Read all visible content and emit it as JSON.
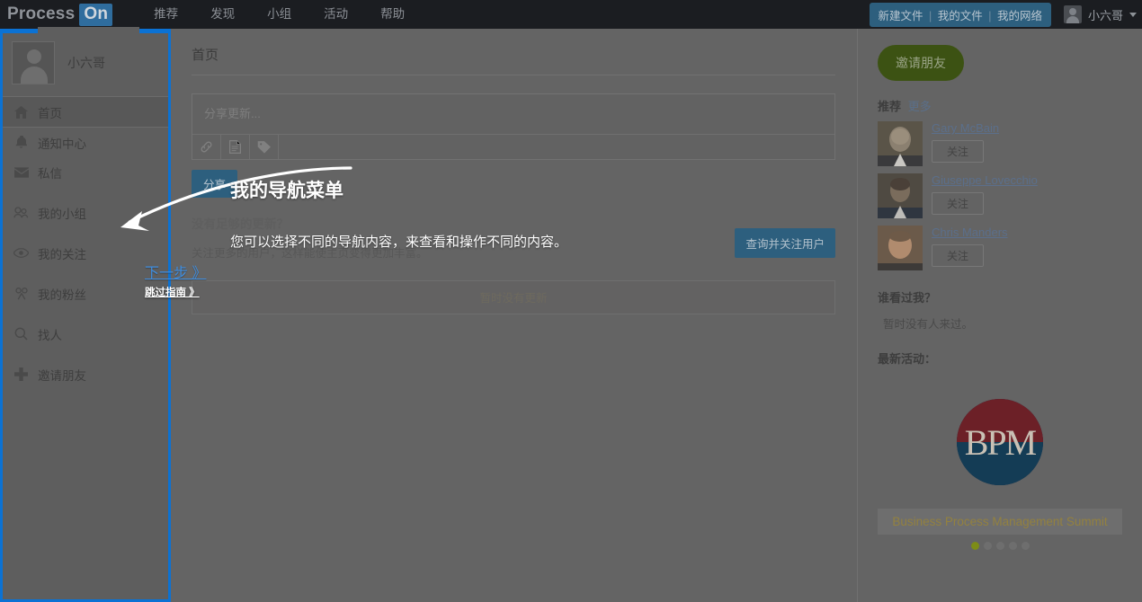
{
  "topnav": {
    "logo_process": "Process",
    "logo_on": "On",
    "links": [
      "推荐",
      "发现",
      "小组",
      "活动",
      "帮助"
    ],
    "file_buttons": [
      "新建文件",
      "我的文件",
      "我的网络"
    ],
    "separator": "|",
    "user_name": "小六哥",
    "avatar_icon": "user-avatar-icon",
    "caret_icon": "chevron-down-icon"
  },
  "sidebar": {
    "profile_name": "小六哥",
    "profile_avatar_icon": "user-avatar-icon",
    "items": [
      {
        "label": "首页",
        "icon": "home-icon",
        "glyph": "⌂",
        "active": true
      },
      {
        "label": "通知中心",
        "icon": "bell-icon",
        "glyph": "🔔",
        "active": false
      },
      {
        "label": "私信",
        "icon": "envelope-icon",
        "glyph": "✉",
        "active": false
      },
      {
        "label": "我的小组",
        "icon": "group-icon",
        "glyph": "👥",
        "active": false
      },
      {
        "label": "我的关注",
        "icon": "eye-icon",
        "glyph": "◉",
        "active": false
      },
      {
        "label": "我的粉丝",
        "icon": "fans-icon",
        "glyph": "☍",
        "active": false
      },
      {
        "label": "找人",
        "icon": "search-icon",
        "glyph": "🔍",
        "active": false
      },
      {
        "label": "邀请朋友",
        "icon": "plus-cross-icon",
        "glyph": "✚",
        "active": false
      }
    ]
  },
  "main": {
    "page_title": "首页",
    "share_placeholder": "分享更新...",
    "share_tools": [
      {
        "name": "attach-link-icon",
        "glyph": "🔗"
      },
      {
        "name": "attach-document-icon",
        "glyph": "📄"
      },
      {
        "name": "attach-tag-icon",
        "glyph": "🏷"
      }
    ],
    "share_button": "分享",
    "empty_heading": "没有足够的更新？",
    "empty_text": "关注更多的用户，这样能使主页变得更加丰富。",
    "follow_users_button": "查询并关注用户",
    "no_updates": "暂时没有更新"
  },
  "rightbar": {
    "invite_button": "邀请朋友",
    "recommend_label": "推荐",
    "recommend_more": "更多",
    "people": [
      {
        "name": "Gary McBain",
        "follow": "关注"
      },
      {
        "name": "Giuseppe Lovecchio",
        "follow": "关注"
      },
      {
        "name": "Chris Manders",
        "follow": "关注"
      }
    ],
    "visitors_heading": "谁看过我？",
    "visitors_text": "暂时没有人来过。",
    "activity_heading": "最新活动：",
    "activity_logo_text": "BPM",
    "activity_caption": "Business Process Management Summit",
    "carousel_total": 5,
    "carousel_active": 0
  },
  "tour": {
    "title": "我的导航菜单",
    "description": "您可以选择不同的导航内容，来查看和操作不同的内容。",
    "next_label": "下一步 》",
    "skip_label": "跳过指南 》",
    "highlight_color": "#0b72d4"
  }
}
